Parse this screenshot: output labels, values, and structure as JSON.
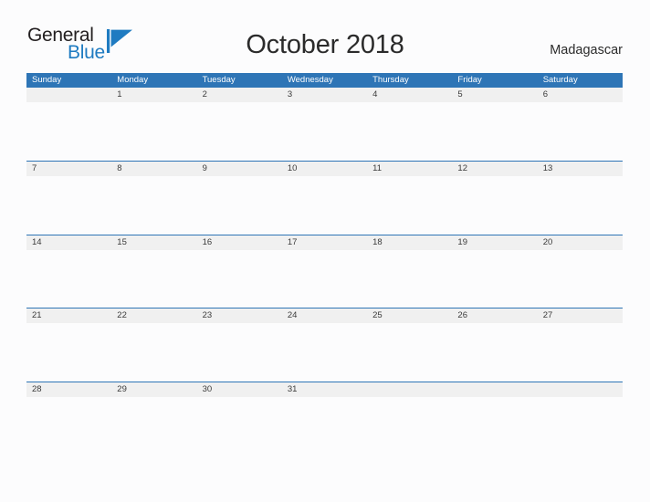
{
  "brand": {
    "name_part1": "General",
    "name_part2": "Blue",
    "flag_icon": "blue-triangle-flag-icon",
    "color_primary": "#1f7bc1",
    "color_text": "#231f20"
  },
  "header": {
    "title": "October 2018",
    "country": "Madagascar"
  },
  "calendar": {
    "accent_color": "#2e75b6",
    "band_color": "#f0f0f0",
    "weekdays": [
      "Sunday",
      "Monday",
      "Tuesday",
      "Wednesday",
      "Thursday",
      "Friday",
      "Saturday"
    ],
    "weeks": [
      [
        "",
        "1",
        "2",
        "3",
        "4",
        "5",
        "6"
      ],
      [
        "7",
        "8",
        "9",
        "10",
        "11",
        "12",
        "13"
      ],
      [
        "14",
        "15",
        "16",
        "17",
        "18",
        "19",
        "20"
      ],
      [
        "21",
        "22",
        "23",
        "24",
        "25",
        "26",
        "27"
      ],
      [
        "28",
        "29",
        "30",
        "31",
        "",
        "",
        ""
      ]
    ]
  }
}
